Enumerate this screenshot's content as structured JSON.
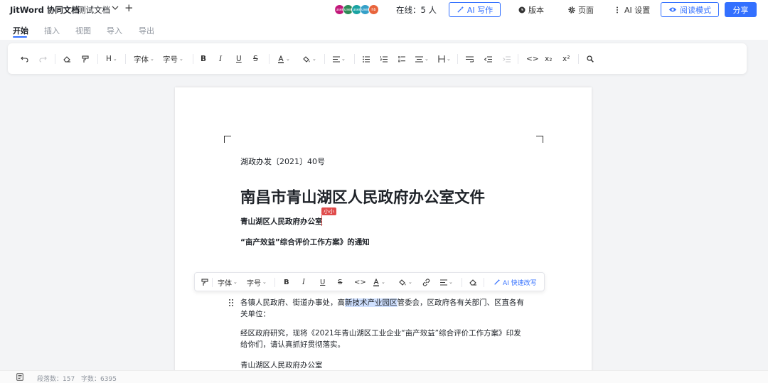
{
  "header": {
    "app_title": "JitWord 协同文档",
    "doc_name": "测试文档",
    "online_label": "在线：",
    "online_count": "5 人",
    "avatars": [
      {
        "label": "user",
        "color": "#c2187a"
      },
      {
        "label": "user",
        "color": "#2e8b57"
      },
      {
        "label": "user",
        "color": "#19a3a3"
      },
      {
        "label": "user",
        "color": "#35a0c8"
      },
      {
        "label": "hb",
        "color": "#e8643c"
      }
    ],
    "ai_write": "AI 写作",
    "version": "版本",
    "page": "页面",
    "ai_settings": "AI 设置",
    "read_mode": "阅读模式",
    "share": "分享"
  },
  "menu_tabs": [
    "开始",
    "插入",
    "视图",
    "导入",
    "导出"
  ],
  "toolbar": {
    "heading": "H",
    "font": "字体",
    "font_size": "字号",
    "bold": "B",
    "italic": "I",
    "underline": "U",
    "strike": "S",
    "code": "<>",
    "subscript": "x₂",
    "superscript": "x²"
  },
  "document": {
    "doc_number": "湖政办发〔2021〕40号",
    "title": "南昌市青山湖区人民政府办公室文件",
    "issuer": "青山湖区人民政府办公室",
    "collaborator_tag": "小小",
    "notice_title": "“亩产效益”综合评价工作方案》的通知",
    "para1_before": "各镇人民政府、街道办事处，高",
    "para1_highlight": "新技术产业园区",
    "para1_after": "管委会，区政府各有关部门、区直各有关单位：",
    "para2": "经区政府研究，现将《2021年青山湖区工业企业“亩产效益”综合评价工作方案》印发给你们，请认真抓好贯彻落实。",
    "para3": "青山湖区人民政府办公室"
  },
  "bubble_toolbar": {
    "font": "字体",
    "font_size": "字号",
    "bold": "B",
    "italic": "I",
    "underline": "U",
    "strike": "S",
    "code": "<>",
    "ai_rewrite": "AI 快速改写"
  },
  "status": {
    "paragraphs_label": "段落数：",
    "paragraphs": "157",
    "chars_label": "字数：",
    "chars": "6395"
  },
  "colors": {
    "accent": "#3370ff",
    "cursor": "#e04b4b",
    "selection": "#cfe0ff"
  }
}
